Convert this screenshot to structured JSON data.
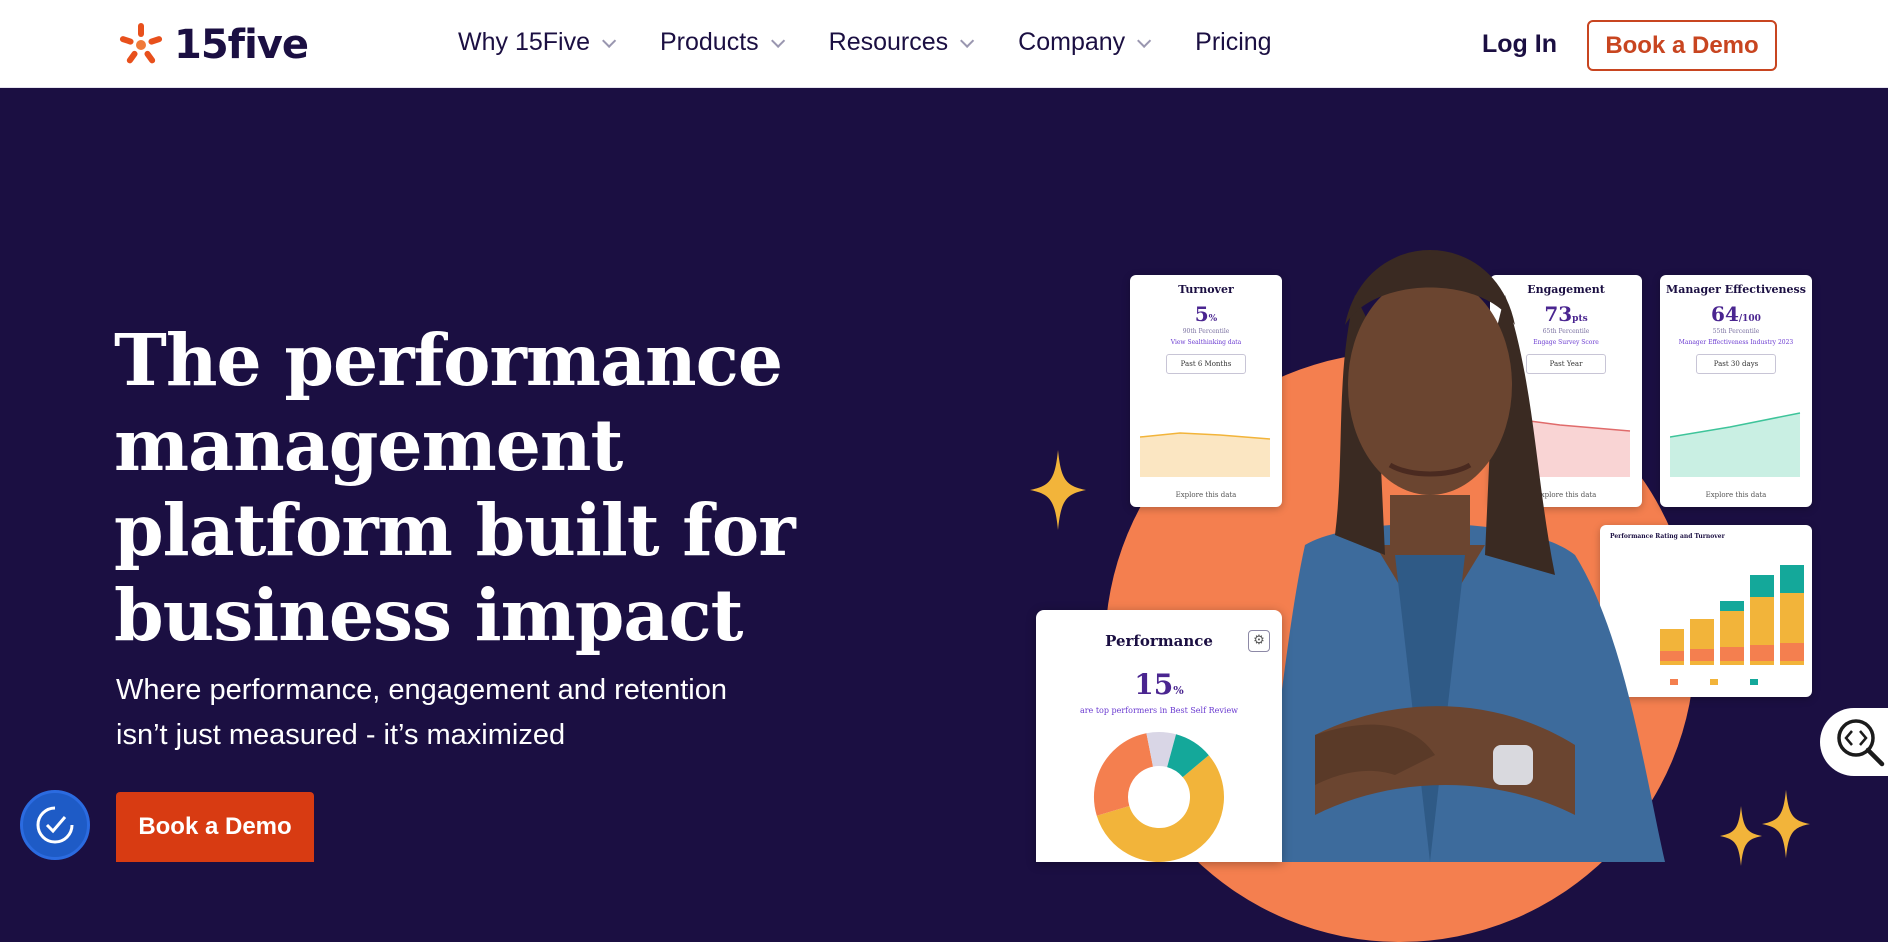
{
  "brand": {
    "name": "15five",
    "accent": "#d83b12",
    "navy": "#1b0f42"
  },
  "nav": {
    "items": [
      {
        "label": "Why 15Five",
        "dropdown": true
      },
      {
        "label": "Products",
        "dropdown": true
      },
      {
        "label": "Resources",
        "dropdown": true
      },
      {
        "label": "Company",
        "dropdown": true
      },
      {
        "label": "Pricing",
        "dropdown": false
      }
    ],
    "login": "Log In",
    "demo": "Book a Demo"
  },
  "hero": {
    "title": "The performance management platform built for business impact",
    "subtitle_line1": "Where performance, engagement and retention",
    "subtitle_line2": "isn’t just measured - it’s maximized",
    "cta": "Book a Demo"
  },
  "cards": {
    "turnover": {
      "title": "Turnover",
      "value": "5",
      "unit": "%",
      "sub": "90th Percentile",
      "link": "View Sealthinking data",
      "button": "Past 6 Months",
      "explore": "Explore this data"
    },
    "engagement": {
      "title": "Engagement",
      "value": "73",
      "unit": "pts",
      "sub": "65th Percentile",
      "link": "Engage Survey Score",
      "button": "Past Year",
      "explore": "Explore this data"
    },
    "manager": {
      "title": "Manager Effectiveness",
      "value": "64",
      "unit": "/100",
      "sub": "55th Percentile",
      "link": "Manager Effectiveness Industry 2023",
      "button": "Past 30 days",
      "explore": "Explore this data"
    },
    "rating": {
      "title": "Performance Rating and Turnover"
    },
    "performance": {
      "title": "Performance",
      "value": "15",
      "unit": "%",
      "note": "are top performers in Best Self Review",
      "gear": "⚙"
    }
  }
}
